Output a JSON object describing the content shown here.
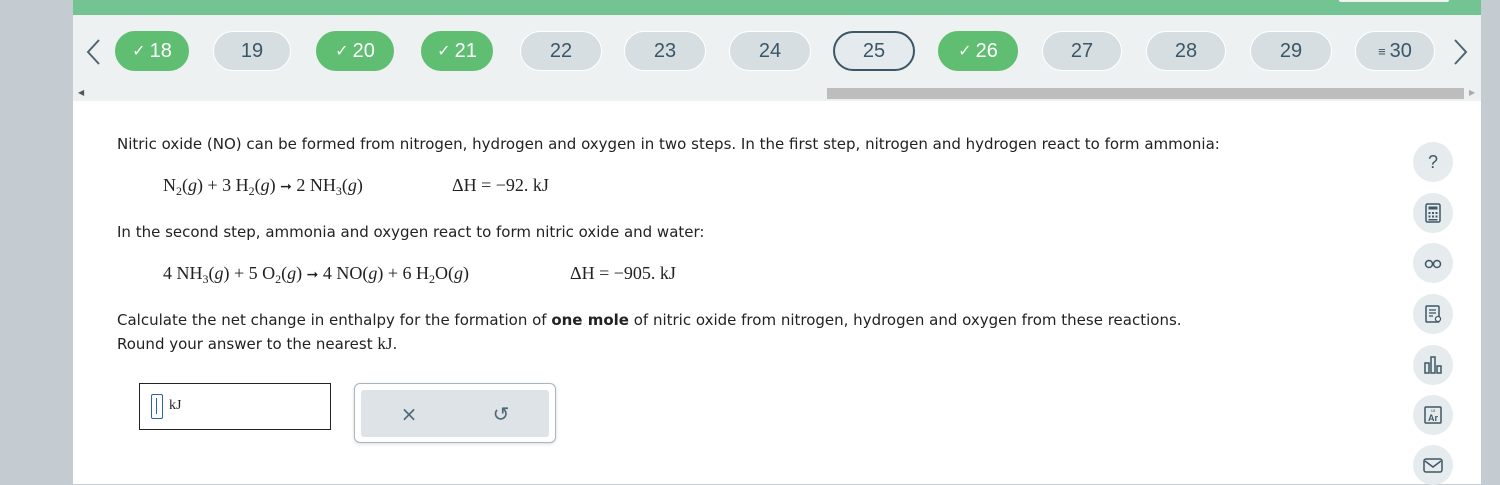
{
  "nav": {
    "questions": [
      {
        "label": "18",
        "state": "done"
      },
      {
        "label": "19",
        "state": "todo"
      },
      {
        "label": "20",
        "state": "done"
      },
      {
        "label": "21",
        "state": "done"
      },
      {
        "label": "22",
        "state": "todo"
      },
      {
        "label": "23",
        "state": "todo"
      },
      {
        "label": "24",
        "state": "todo"
      },
      {
        "label": "25",
        "state": "current"
      },
      {
        "label": "26",
        "state": "done"
      },
      {
        "label": "27",
        "state": "todo"
      },
      {
        "label": "28",
        "state": "todo"
      },
      {
        "label": "29",
        "state": "todo"
      },
      {
        "label": "30",
        "state": "flagged"
      }
    ],
    "check_glyph": "✓",
    "list_glyph": "≡"
  },
  "question": {
    "intro": "Nitric oxide (NO) can be formed from nitrogen, hydrogen and oxygen in two steps. In the first step, nitrogen and hydrogen react to form ammonia:",
    "reaction1_dh": "ΔH = −92. kJ",
    "step2": "In the second step, ammonia and oxygen react to form nitric oxide and water:",
    "reaction2_dh": "ΔH = −905. kJ",
    "prompt_before": "Calculate the net change in enthalpy for the formation of ",
    "prompt_bold": "one mole",
    "prompt_after": " of nitric oxide from nitrogen, hydrogen and oxygen from these reactions.",
    "round_text": "Round your answer to the nearest ",
    "round_unit": "kJ",
    "round_end": "."
  },
  "answer": {
    "value": "",
    "unit": "kJ"
  },
  "tools": {
    "clear": "×",
    "undo": "↺"
  },
  "sidebar_icons": [
    "help-icon",
    "calculator-icon",
    "glasses-icon",
    "notes-icon",
    "chart-icon",
    "periodic-table-icon",
    "mail-icon"
  ],
  "colors": {
    "done": "#5fbe72",
    "band": "#72c493",
    "nav_text": "#3b5666"
  }
}
